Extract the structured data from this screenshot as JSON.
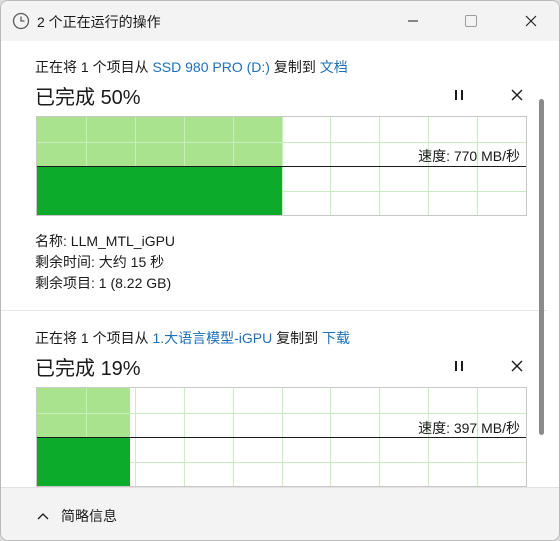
{
  "window": {
    "title": "2 个正在运行的操作"
  },
  "operations": [
    {
      "prefix": "正在将 1 个项目从 ",
      "source": "SSD 980 PRO (D:)",
      "middle": " 复制到 ",
      "destination": "文档",
      "progress_label": "已完成",
      "percent_text": "50%",
      "progress": 0.5,
      "speed": "速度: 770 MB/秒",
      "speed_level": 0.5,
      "name_label": "名称:",
      "name": "LLM_MTL_iGPU",
      "time_label": "剩余时间:",
      "time_remaining": "大约 15 秒",
      "items_label": "剩余项目:",
      "items_remaining": "1 (8.22 GB)"
    },
    {
      "prefix": "正在将 1 个项目从 ",
      "source": "1.大语言模型-iGPU",
      "middle": " 复制到 ",
      "destination": "下载",
      "progress_label": "已完成",
      "percent_text": "19%",
      "progress": 0.19,
      "speed": "速度: 397 MB/秒",
      "speed_level": 0.5
    }
  ],
  "footer": {
    "toggle_label": "简略信息"
  },
  "colors": {
    "graph_fill_light": "#a9e38d",
    "graph_fill_dark": "#0cab2c",
    "graph_grid": "#c9ecc0",
    "link": "#1e6fb7"
  }
}
